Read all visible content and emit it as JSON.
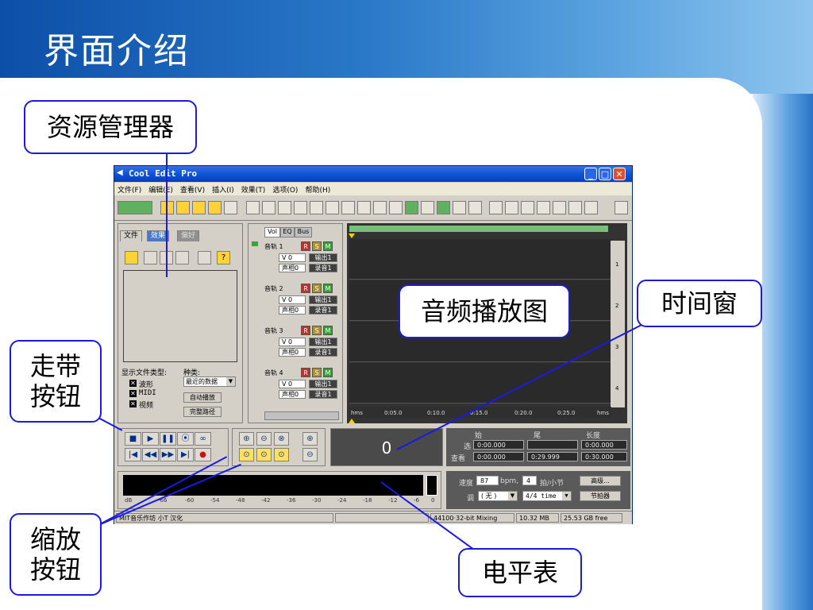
{
  "slide": {
    "title": "界面介绍",
    "callouts": {
      "explorer": "资源管理器",
      "transport": "走带\n按钮",
      "zoom": "缩放\n按钮",
      "waveform": "音频播放图",
      "time": "时间窗",
      "meter": "电平表"
    }
  },
  "app": {
    "title": "Cool Edit Pro",
    "menu": [
      "文件(F)",
      "编辑(E)",
      "查看(V)",
      "插入(I)",
      "效果(T)",
      "选项(O)",
      "帮助(H)"
    ],
    "explorer": {
      "tabs": [
        "文件",
        "效果",
        "偏好"
      ],
      "show_types_label": "显示文件类型:",
      "kind_label": "种类:",
      "kind_value": "最近的数据",
      "types": [
        "波形",
        "MIDI",
        "视频"
      ],
      "auto_play": "自动播放",
      "full_path": "完整路径"
    },
    "tracks": [
      {
        "name": "音轨 1",
        "vol": "V 0",
        "out": "输出1",
        "pan": "声相0",
        "rec": "录音1"
      },
      {
        "name": "音轨 2",
        "vol": "V 0",
        "out": "输出1",
        "pan": "声相0",
        "rec": "录音1"
      },
      {
        "name": "音轨 3",
        "vol": "V 0",
        "out": "输出1",
        "pan": "声相0",
        "rec": "录音1"
      },
      {
        "name": "音轨 4",
        "vol": "V 0",
        "out": "输出1",
        "pan": "声相0",
        "rec": "录音1"
      }
    ],
    "mixer_tabs": [
      "Vol",
      "EQ",
      "Bus"
    ],
    "track_numbers": [
      "1",
      "2",
      "3",
      "4"
    ],
    "ruler_labels": [
      "hms",
      "0:05.0",
      "0:10.0",
      "0:15.0",
      "0:20.0",
      "0:25.0",
      "hms"
    ],
    "time_display": "0",
    "selection": {
      "headers": [
        "始",
        "尾",
        "长度"
      ],
      "sel_label": "选",
      "view_label": "查看",
      "sel_start": "0:00.000",
      "sel_end": "",
      "sel_len": "0:00.000",
      "view_start": "0:00.000",
      "view_end": "0:29.999",
      "view_len": "0:30.000"
    },
    "meter_scale": [
      "dB",
      "-66",
      "-60",
      "-54",
      "-48",
      "-42",
      "-36",
      "-30",
      "-24",
      "-18",
      "-12",
      "-6",
      "0"
    ],
    "tempo": {
      "speed_label": "速度",
      "speed_value": "87",
      "bpm_label": "bpm,",
      "beats_value": "4",
      "beats_label": "拍/小节",
      "advanced": "高级...",
      "key_label": "调",
      "key_value": "( 无 )",
      "time_sig": "4/4 time",
      "metronome": "节拍器"
    },
    "status": {
      "left": "MIT音乐作坊 小T 汉化",
      "format": "44100·32-bit Mixing",
      "mem": "10.32 MB",
      "disk": "25.53 GB free"
    }
  }
}
